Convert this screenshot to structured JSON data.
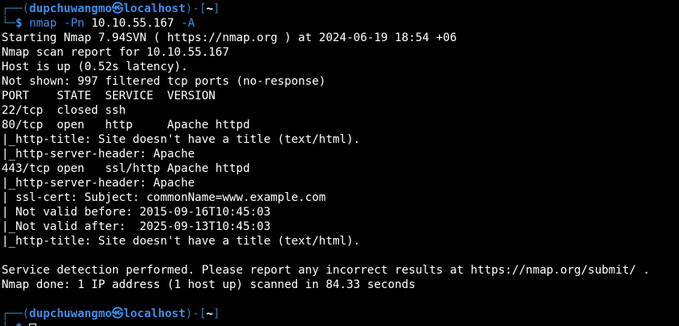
{
  "prompt": {
    "top_left": "┌──(",
    "user": "dupchuwangmo",
    "at_symbol": "㉿",
    "host": "localhost",
    "mid": ")-[",
    "path": "~",
    "end": "]",
    "bottom_left": "└─",
    "dollar": "$"
  },
  "command": {
    "program": "nmap",
    "flag1": "-Pn",
    "target": "10.10.55.167",
    "flag2": "-A"
  },
  "output_lines": [
    "Starting Nmap 7.94SVN ( https://nmap.org ) at 2024-06-19 18:54 +06",
    "Nmap scan report for 10.10.55.167",
    "Host is up (0.52s latency).",
    "Not shown: 997 filtered tcp ports (no-response)",
    "PORT    STATE  SERVICE  VERSION",
    "22/tcp  closed ssh",
    "80/tcp  open   http     Apache httpd",
    "|_http-title: Site doesn't have a title (text/html).",
    "|_http-server-header: Apache",
    "443/tcp open   ssl/http Apache httpd",
    "|_http-server-header: Apache",
    "| ssl-cert: Subject: commonName=www.example.com",
    "| Not valid before: 2015-09-16T10:45:03",
    "|_Not valid after:  2025-09-13T10:45:03",
    "|_http-title: Site doesn't have a title (text/html).",
    "",
    "Service detection performed. Please report any incorrect results at https://nmap.org/submit/ .",
    "Nmap done: 1 IP address (1 host up) scanned in 84.33 seconds",
    ""
  ],
  "colors": {
    "background": "#000000",
    "prompt_blue": "#3b8eea",
    "text": "#ffffff"
  }
}
